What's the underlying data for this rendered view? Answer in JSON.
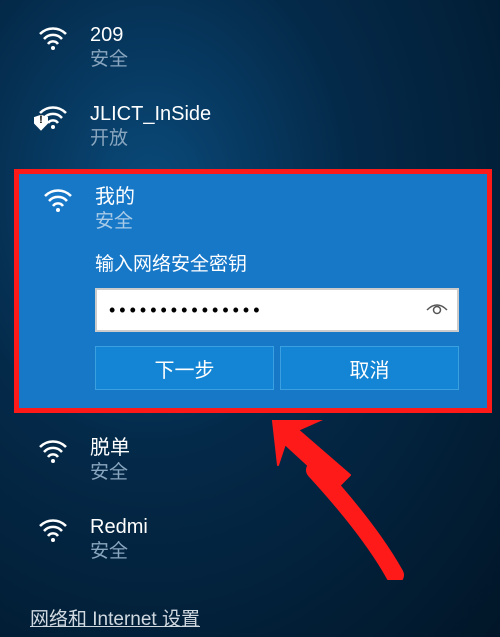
{
  "networks": [
    {
      "name": "209",
      "status": "安全",
      "shield": false
    },
    {
      "name": "JLICT_InSide",
      "status": "开放",
      "shield": true
    }
  ],
  "selected": {
    "name": "我的",
    "status": "安全",
    "prompt": "输入网络安全密钥",
    "password_mask": "●●●●●●●●●●●●●●●",
    "next_label": "下一步",
    "cancel_label": "取消"
  },
  "networks_after": [
    {
      "name": "脱单",
      "status": "安全",
      "shield": false
    },
    {
      "name": "Redmi",
      "status": "安全",
      "shield": false
    }
  ],
  "footer_link": "网络和 Internet 设置",
  "colors": {
    "selected_bg": "#1878c8",
    "highlight_border": "#ff1a1a"
  }
}
